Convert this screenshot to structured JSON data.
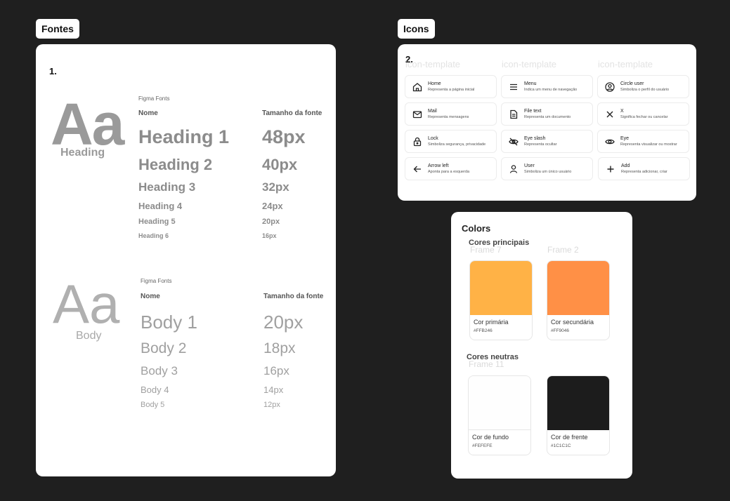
{
  "fonts_frame": {
    "label": "Fontes",
    "section_number": "1.",
    "heading_group": {
      "sample": "Aa",
      "caption": "Heading",
      "source": "Figma  Fonts",
      "col_name": "Nome",
      "col_size": "Tamanho da fonte",
      "rows": [
        {
          "name": "Heading 1",
          "size": "48px"
        },
        {
          "name": "Heading 2",
          "size": "40px"
        },
        {
          "name": "Heading 3",
          "size": "32px"
        },
        {
          "name": "Heading 4",
          "size": "24px"
        },
        {
          "name": "Heading 5",
          "size": "20px"
        },
        {
          "name": "Heading 6",
          "size": "16px"
        }
      ]
    },
    "body_group": {
      "sample": "Aa",
      "caption": "Body",
      "source": "Figma Fonts",
      "col_name": "Nome",
      "col_size": "Tamanho da fonte",
      "rows": [
        {
          "name": "Body 1",
          "size": "20px"
        },
        {
          "name": "Body 2",
          "size": "18px"
        },
        {
          "name": "Body 3",
          "size": "16px"
        },
        {
          "name": "Body 4",
          "size": "14px"
        },
        {
          "name": "Body 5",
          "size": "12px"
        }
      ]
    }
  },
  "icons_frame": {
    "label": "Icons",
    "section_number": "2.",
    "ghost_label": "icon-template",
    "items": [
      {
        "icon": "home-icon",
        "title": "Home",
        "desc": "Representa a página inicial"
      },
      {
        "icon": "menu-icon",
        "title": "Menu",
        "desc": "Indica um menu de navegação"
      },
      {
        "icon": "circle-user-icon",
        "title": "Circle user",
        "desc": "Simboliza o perfil do usuário"
      },
      {
        "icon": "mail-icon",
        "title": "Mail",
        "desc": "Representa mensagens"
      },
      {
        "icon": "file-text-icon",
        "title": "File text",
        "desc": "Representa um documento"
      },
      {
        "icon": "x-icon",
        "title": "X",
        "desc": "Significa fechar ou cancelar"
      },
      {
        "icon": "lock-icon",
        "title": "Lock",
        "desc": "Simboliza segurança, privacidade"
      },
      {
        "icon": "eye-slash-icon",
        "title": "Eye slash",
        "desc": "Representa ocultar"
      },
      {
        "icon": "eye-icon",
        "title": "Eye",
        "desc": "Representa visualizar ou mostrar"
      },
      {
        "icon": "arrow-left-icon",
        "title": "Arrow left",
        "desc": "Aponta para a esquerda"
      },
      {
        "icon": "user-icon",
        "title": "User",
        "desc": "Simboliza um único usuário"
      },
      {
        "icon": "plus-icon",
        "title": "Add",
        "desc": "Representa adicionar, criar"
      }
    ]
  },
  "colors_frame": {
    "title": "Colors",
    "main_group": "Cores principais",
    "neutral_group": "Cores neutras",
    "ghost_frames": [
      "Frame 7",
      "Frame 2",
      "Frame 11"
    ],
    "main": [
      {
        "name": "Cor primária",
        "hex": "#FFB246",
        "color": "#FFB246"
      },
      {
        "name": "Cor secundária",
        "hex": "#FF9046",
        "color": "#FF9046"
      }
    ],
    "neutral": [
      {
        "name": "Cor de fundo",
        "hex": "#FEFEFE",
        "color": "#FEFEFE"
      },
      {
        "name": "Cor de frente",
        "hex": "#1C1C1C",
        "color": "#1C1C1C"
      }
    ]
  }
}
